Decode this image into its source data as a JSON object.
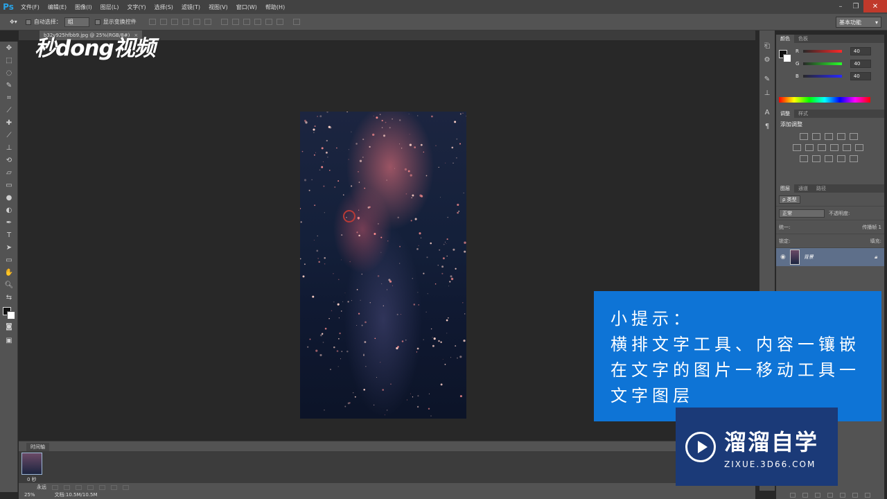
{
  "app": {
    "logo": "Ps"
  },
  "menu": [
    "文件(F)",
    "编辑(E)",
    "图像(I)",
    "图层(L)",
    "文字(Y)",
    "选择(S)",
    "滤镜(T)",
    "视图(V)",
    "窗口(W)",
    "帮助(H)"
  ],
  "options": {
    "auto_select_label": "自动选择：",
    "auto_select_value": "组",
    "show_transform_label": "显示变换控件",
    "workspace": "基本功能"
  },
  "document": {
    "tab_label": "b32v925hfbb9.jpg @ 25%(RGB/8#)",
    "close": "×"
  },
  "watermark": {
    "logo_text": "秒dong视频"
  },
  "timeline": {
    "tab": "时间轴",
    "frame_time": "0 秒",
    "loop": "永远"
  },
  "status": {
    "zoom": "25%",
    "doc_size": "文档:10.5M/10.5M"
  },
  "color_panel": {
    "tabs": [
      "颜色",
      "色板"
    ],
    "r_label": "R",
    "g_label": "G",
    "b_label": "B",
    "r": "40",
    "g": "40",
    "b": "40"
  },
  "adjustments_panel": {
    "tabs": [
      "调整",
      "样式"
    ],
    "title": "添加调整"
  },
  "layers_panel": {
    "tabs": [
      "图层",
      "通道",
      "路径"
    ],
    "kind_filter": "ρ 类型",
    "blend_mode": "正常",
    "opacity_label": "不透明度:",
    "unify_label": "统一:",
    "propagate_label": "传播帧 1",
    "lock_label": "锁定:",
    "fill_label": "填充:",
    "layer_name": "背景"
  },
  "tip": {
    "lines": [
      "小提示：",
      "横排文字工具、内容一镶嵌",
      "在文字的图片一移动工具一",
      "文字图层"
    ]
  },
  "brand": {
    "name": "溜溜自学",
    "url": "ZIXUE.3D66.COM"
  }
}
